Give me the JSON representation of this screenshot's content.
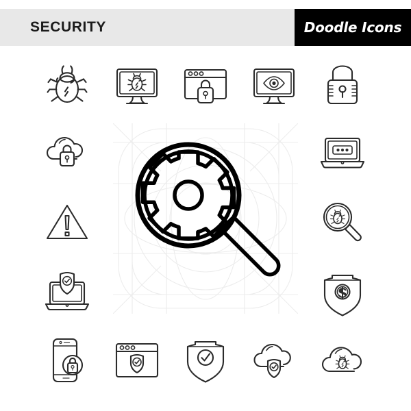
{
  "header": {
    "title": "SECURITY",
    "badge_label": "Doodle Icons",
    "band_color": "#e8e8e8",
    "badge_bg_color": "#000000",
    "badge_text_color": "#ffffff",
    "title_color": "#1b1b1b"
  },
  "style": {
    "background_color": "#ffffff",
    "icon_stroke_color": "#2b2b2b",
    "feature_stroke_color": "#000000",
    "guide_grid_color": "#ececec"
  },
  "feature_icon": {
    "name": "magnifier-gear-icon",
    "label": "Magnifying glass with gear",
    "has_guide_grid": true
  },
  "grid": {
    "columns": 5,
    "rows": 5,
    "icons": [
      {
        "row": 0,
        "col": 0,
        "name": "bug-icon",
        "label": "Bug"
      },
      {
        "row": 0,
        "col": 1,
        "name": "monitor-bug-icon",
        "label": "Monitor with bug"
      },
      {
        "row": 0,
        "col": 2,
        "name": "browser-lock-icon",
        "label": "Browser window with padlock"
      },
      {
        "row": 0,
        "col": 3,
        "name": "monitor-eye-icon",
        "label": "Monitor with eye"
      },
      {
        "row": 0,
        "col": 4,
        "name": "padlock-icon",
        "label": "Padlock"
      },
      {
        "row": 1,
        "col": 0,
        "name": "cloud-lock-icon",
        "label": "Cloud with padlock"
      },
      {
        "row": 1,
        "col": 4,
        "name": "laptop-password-icon",
        "label": "Laptop with password field"
      },
      {
        "row": 2,
        "col": 0,
        "name": "warning-triangle-icon",
        "label": "Warning triangle"
      },
      {
        "row": 2,
        "col": 4,
        "name": "magnifier-bug-icon",
        "label": "Magnifying glass with bug"
      },
      {
        "row": 3,
        "col": 0,
        "name": "laptop-shield-icon",
        "label": "Laptop with shield"
      },
      {
        "row": 3,
        "col": 4,
        "name": "shield-dollar-icon",
        "label": "Shield with dollar sign"
      },
      {
        "row": 4,
        "col": 0,
        "name": "phone-lock-icon",
        "label": "Smartphone with padlock"
      },
      {
        "row": 4,
        "col": 1,
        "name": "browser-shield-icon",
        "label": "Browser window with shield"
      },
      {
        "row": 4,
        "col": 2,
        "name": "shield-check-icon",
        "label": "Shield with checkmark"
      },
      {
        "row": 4,
        "col": 3,
        "name": "cloud-shield-icon",
        "label": "Cloud with shield"
      },
      {
        "row": 4,
        "col": 4,
        "name": "cloud-bug-icon",
        "label": "Cloud with bug"
      }
    ]
  }
}
